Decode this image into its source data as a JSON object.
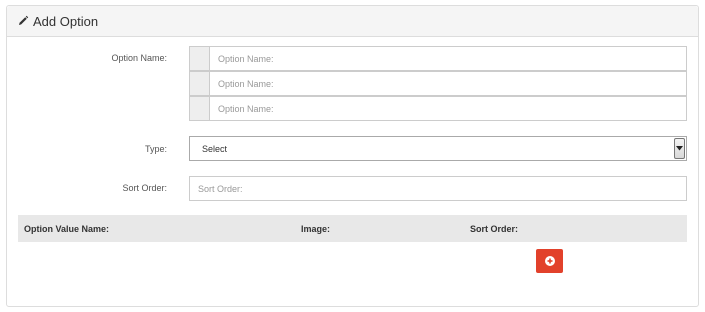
{
  "panel": {
    "title": "Add Option",
    "title_icon": "pencil-icon"
  },
  "form": {
    "option_name": {
      "label": "Option Name:",
      "inputs": [
        {
          "placeholder": "Option Name:"
        },
        {
          "placeholder": "Option Name:"
        },
        {
          "placeholder": "Option Name:"
        }
      ]
    },
    "type": {
      "label": "Type:",
      "selected": "Select"
    },
    "sort_order": {
      "label": "Sort Order:",
      "placeholder": "Sort Order:"
    }
  },
  "values_table": {
    "columns": [
      "Option Value Name:",
      "Image:",
      "Sort Order:"
    ],
    "rows": []
  },
  "add_button": {
    "icon": "plus-circle-icon",
    "color": "#e2412b"
  }
}
